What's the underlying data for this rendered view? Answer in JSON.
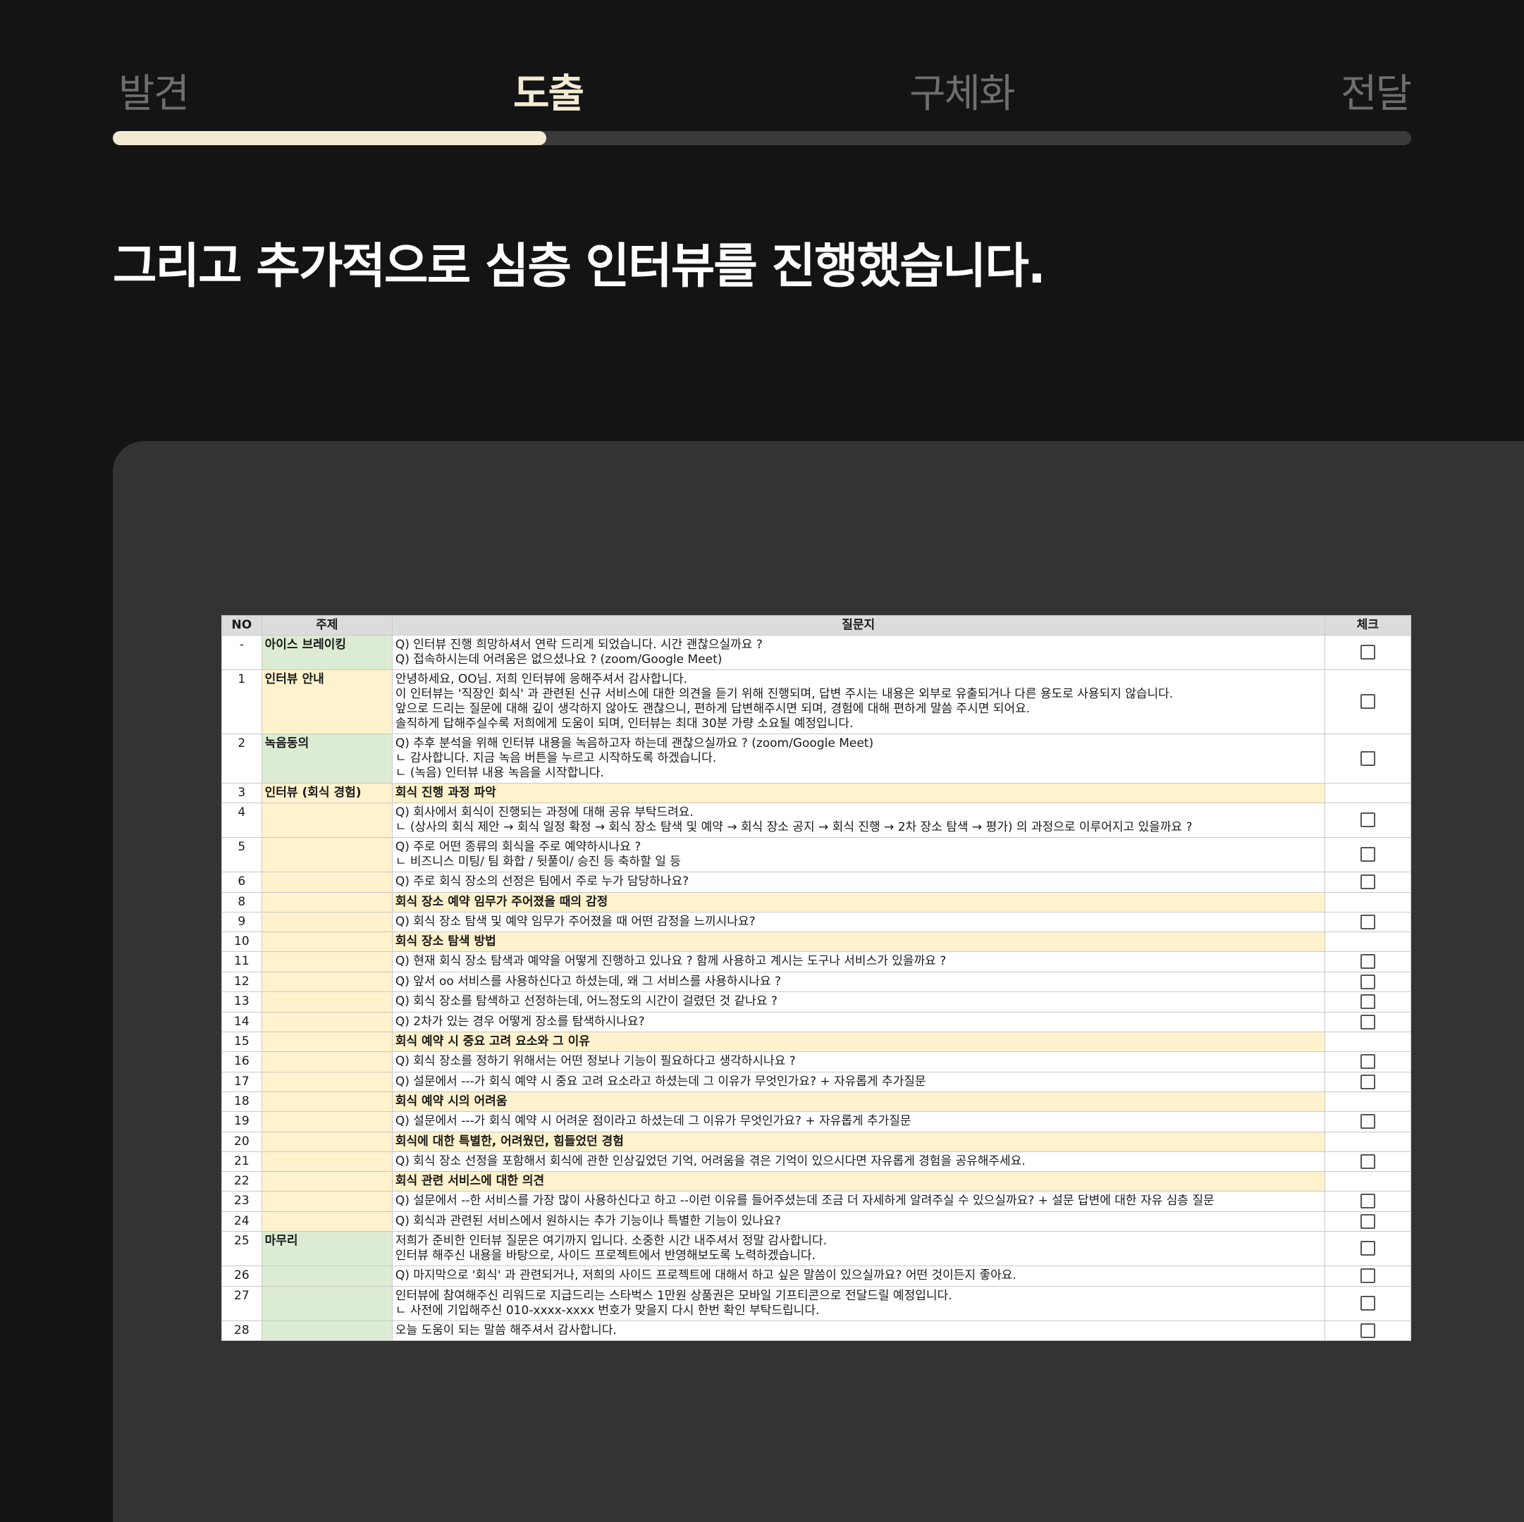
{
  "steps": [
    {
      "label": "발견",
      "active": false
    },
    {
      "label": "도출",
      "active": true
    },
    {
      "label": "구체화",
      "active": false
    },
    {
      "label": "전달",
      "active": false
    }
  ],
  "progress": 0.334,
  "heading": "그리고 추가적으로 심층 인터뷰를 진행했습니다.",
  "colors": {
    "bg": "#141414",
    "accent": "#f3ead3",
    "panel": "#333333",
    "green": "#dbecd2",
    "yellow": "#fff2cc"
  },
  "table": {
    "headers": [
      "NO",
      "주제",
      "질문지",
      "체크"
    ],
    "rows": [
      {
        "no": "-",
        "topic": "아이스 브레이킹",
        "topic_color": "green",
        "lines": [
          "Q) 인터뷰 진행 희망하셔서 연락 드리게 되었습니다. 시간 괜찮으실까요 ?",
          "Q) 접속하시는데 어려움은 없으셨나요 ? (zoom/Google Meet)"
        ],
        "check": true
      },
      {
        "no": "1",
        "topic": "인터뷰 안내",
        "topic_color": "yellow",
        "lines": [
          "안녕하세요, OO님. 저희 인터뷰에 응해주셔서 감사합니다.",
          "이 인터뷰는 '직장인 회식' 과 관련된 신규 서비스에 대한 의견을 듣기 위해 진행되며, 답변 주시는 내용은 외부로 유출되거나 다른 용도로 사용되지 않습니다.",
          "앞으로 드리는 질문에 대해 깊이 생각하지 않아도 괜찮으니, 편하게 답변해주시면 되며, 경험에 대해 편하게 말씀 주시면 되어요.",
          "솔직하게 답해주실수록 저희에게 도움이 되며, 인터뷰는 최대 30분 가량 소요될 예정입니다."
        ],
        "check": true
      },
      {
        "no": "2",
        "topic": "녹음동의",
        "topic_color": "green",
        "lines": [
          "Q) 추후 분석을 위해 인터뷰 내용을 녹음하고자 하는데 괜찮으실까요 ? (zoom/Google Meet)",
          "ㄴ 감사합니다. 지금 녹음 버튼을 누르고 시작하도록 하겠습니다.",
          "ㄴ (녹음) 인터뷰 내용 녹음을 시작합니다."
        ],
        "check": true
      },
      {
        "no": "3",
        "topic": "인터뷰 (회식 경험)",
        "topic_color": "yellow",
        "section": true,
        "lines": [
          "회식 진행 과정 파악"
        ],
        "check": false
      },
      {
        "no": "4",
        "topic": "",
        "topic_color": "yellow",
        "lines": [
          "Q) 회사에서 회식이 진행되는 과정에 대해 공유 부탁드려요.",
          "ㄴ (상사의 회식 제안 → 회식 일정 확정 → 회식 장소 탐색 및 예약 → 회식 장소 공지 → 회식 진행 → 2차 장소 탐색 → 평가) 의 과정으로 이루어지고 있을까요 ?"
        ],
        "check": true
      },
      {
        "no": "5",
        "topic": "",
        "topic_color": "yellow",
        "lines": [
          "Q) 주로 어떤 종류의 회식을 주로 예약하시나요 ?",
          "ㄴ 비즈니스 미팅/ 팀 화합 / 뒷풀이/ 승진 등 축하할 일 등"
        ],
        "check": true
      },
      {
        "no": "6",
        "topic": "",
        "topic_color": "yellow",
        "lines": [
          "Q) 주로 회식 장소의 선정은 팀에서 주로 누가 담당하나요?"
        ],
        "check": true
      },
      {
        "no": "8",
        "topic": "",
        "topic_color": "yellow",
        "section": true,
        "lines": [
          "회식 장소 예약 임무가 주어졌을 때의 감정"
        ],
        "check": false
      },
      {
        "no": "9",
        "topic": "",
        "topic_color": "yellow",
        "lines": [
          "Q) 회식 장소 탐색 및 예약 임무가 주어졌을 때 어떤 감정을 느끼시나요?"
        ],
        "check": true
      },
      {
        "no": "10",
        "topic": "",
        "topic_color": "yellow",
        "section": true,
        "lines": [
          "회식 장소 탐색 방법"
        ],
        "check": false
      },
      {
        "no": "11",
        "topic": "",
        "topic_color": "yellow",
        "lines": [
          "Q) 현재 회식 장소 탐색과 예약을 어떻게 진행하고 있나요 ? 함께 사용하고 계시는 도구나 서비스가 있을까요 ?"
        ],
        "check": true
      },
      {
        "no": "12",
        "topic": "",
        "topic_color": "yellow",
        "lines": [
          "Q) 앞서 oo 서비스를 사용하신다고 하셨는데, 왜 그 서비스를 사용하시나요 ?"
        ],
        "check": true
      },
      {
        "no": "13",
        "topic": "",
        "topic_color": "yellow",
        "lines": [
          "Q) 회식 장소를 탐색하고 선정하는데, 어느정도의 시간이 걸렸던 것 같나요 ?"
        ],
        "check": true
      },
      {
        "no": "14",
        "topic": "",
        "topic_color": "yellow",
        "lines": [
          "Q) 2차가 있는 경우 어떻게 장소를 탐색하시나요?"
        ],
        "check": true
      },
      {
        "no": "15",
        "topic": "",
        "topic_color": "yellow",
        "section": true,
        "lines": [
          "회식 예약 시 중요 고려 요소와 그 이유"
        ],
        "check": false
      },
      {
        "no": "16",
        "topic": "",
        "topic_color": "yellow",
        "lines": [
          "Q) 회식 장소를 정하기 위해서는 어떤 정보나 기능이 필요하다고 생각하시나요 ?"
        ],
        "check": true
      },
      {
        "no": "17",
        "topic": "",
        "topic_color": "yellow",
        "lines": [
          "Q) 설문에서 ---가 회식 예약 시 중요 고려 요소라고 하셨는데 그 이유가 무엇인가요? + 자유롭게 추가질문"
        ],
        "check": true
      },
      {
        "no": "18",
        "topic": "",
        "topic_color": "yellow",
        "section": true,
        "lines": [
          "회식 예약 시의 어려움"
        ],
        "check": false
      },
      {
        "no": "19",
        "topic": "",
        "topic_color": "yellow",
        "lines": [
          "Q) 설문에서 ---가 회식 예약 시 어려운 점이라고 하셨는데 그 이유가 무엇인가요? + 자유롭게 추가질문"
        ],
        "check": true
      },
      {
        "no": "20",
        "topic": "",
        "topic_color": "yellow",
        "section": true,
        "lines": [
          "회식에 대한 특별한, 어려웠던, 힘들었던 경험"
        ],
        "check": false
      },
      {
        "no": "21",
        "topic": "",
        "topic_color": "yellow",
        "lines": [
          "Q) 회식 장소 선정을 포함해서 회식에 관한 인상깊었던 기억, 어려움을 겪은 기억이 있으시다면 자유롭게 경험을 공유해주세요."
        ],
        "check": true
      },
      {
        "no": "22",
        "topic": "",
        "topic_color": "yellow",
        "section": true,
        "lines": [
          "회식 관련 서비스에 대한 의견"
        ],
        "check": false
      },
      {
        "no": "23",
        "topic": "",
        "topic_color": "yellow",
        "lines": [
          "Q) 설문에서 --한 서비스를 가장 많이 사용하신다고 하고 --이런 이유를 들어주셨는데 조금 더 자세하게 알려주실 수 있으실까요? + 설문 답변에 대한 자유 심층 질문"
        ],
        "check": true
      },
      {
        "no": "24",
        "topic": "",
        "topic_color": "yellow",
        "lines": [
          "Q) 회식과 관련된 서비스에서 원하시는 추가 기능이나 특별한 기능이 있나요?"
        ],
        "check": true
      },
      {
        "no": "25",
        "topic": "마무리",
        "topic_color": "green",
        "lines": [
          "저희가 준비한 인터뷰 질문은 여기까지 입니다. 소중한 시간 내주셔서 정말 감사합니다.",
          "인터뷰 해주신 내용을 바탕으로, 사이드 프로젝트에서 반영해보도록 노력하겠습니다."
        ],
        "check": true
      },
      {
        "no": "26",
        "topic": "",
        "topic_color": "green",
        "lines": [
          "Q) 마지막으로 '회식' 과 관련되거나, 저희의 사이드 프로젝트에 대해서 하고 싶은 말씀이 있으실까요? 어떤 것이든지 좋아요."
        ],
        "check": true
      },
      {
        "no": "27",
        "topic": "",
        "topic_color": "green",
        "lines": [
          "인터뷰에 참여해주신 리워드로 지급드리는 스타벅스 1만원 상품권은 모바일 기프티콘으로 전달드릴 예정입니다.",
          "ㄴ 사전에 기입해주신 010-xxxx-xxxx 번호가 맞을지 다시 한번 확인 부탁드립니다."
        ],
        "check": true
      },
      {
        "no": "28",
        "topic": "",
        "topic_color": "green",
        "lines": [
          "오늘 도움이 되는 말씀 해주셔서 감사합니다."
        ],
        "check": true
      }
    ]
  }
}
